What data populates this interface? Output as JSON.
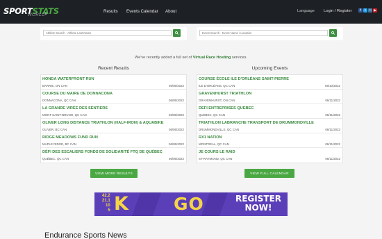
{
  "header": {
    "logo_sport": "SPORT",
    "logo_stats": "STATS",
    "logo_world": "WORLD",
    "nav": [
      "Results",
      "Events Calendar",
      "About"
    ],
    "language": "Language",
    "login": "Login / Register",
    "social_icons": [
      "facebook-icon",
      "twitter-icon",
      "instagram-icon",
      "youtube-icon"
    ]
  },
  "search": {
    "athlete_placeholder": "Athlete Search - Athlete Last Name",
    "event_placeholder": "Event Search - Event Name / Location"
  },
  "promo": {
    "text_before": "We've recently added a full set of ",
    "link": "Virtual Race Hosting",
    "text_after": " services."
  },
  "recent": {
    "title": "Recent Results",
    "items": [
      {
        "name": "HONDA WATERFRONT RUN",
        "location": "BARRIE, ON CAN",
        "date": "06/05/2022"
      },
      {
        "name": "COURSE DU MAIRE DE DONNACONA",
        "location": "DONNACONA, QC CAN",
        "date": "06/05/2022"
      },
      {
        "name": "LA GRANDE VIRÉE DES SENTIERS",
        "location": "MONT-SAINT-BRUNO, QC CAN",
        "date": "06/05/2022"
      },
      {
        "name": "OLIVER LONG DISTANCE TRIATHLON (HALF-IRON) & AQUABIKE",
        "location": "OLIVER, BC CAN",
        "date": "06/05/2022"
      },
      {
        "name": "RIDGE MEADOWS FUND RUN",
        "location": "MAPLE RIDGE, BC CAN",
        "date": "06/05/2022"
      },
      {
        "name": "DÉFI DES ESCALIERS FONDS DE SOLIDARITÉ FTQ DE QUÉBEC",
        "location": "QUÉBEC, QC CAN",
        "date": "06/05/2022"
      }
    ],
    "button": "VIEW MORE RESULTS"
  },
  "upcoming": {
    "title": "Upcoming Events",
    "items": [
      {
        "name": "COURSE ÉCOLE ILE D'ORLÉANS SAINT-PIERRE",
        "location": "ILE D'ORLÉANS, QC CAN",
        "date": "06/10/2022"
      },
      {
        "name": "GRAVENHURST TRIATHLON",
        "location": "GRAVENHURST, ON CAN",
        "date": "06/11/2022"
      },
      {
        "name": "DEFI ENTREPRISES QUEBEC",
        "location": "QUEBEC, QC CAN",
        "date": "06/11/2022"
      },
      {
        "name": "TRIATHLON LABRANCHE TRANSPORT DE DRUMMONDVILLE",
        "location": "DRUMMONDVILLE, QC CAN",
        "date": "06/11/2022"
      },
      {
        "name": "RX1 NATION",
        "location": "MONTREAL, QC CAN",
        "date": "06/11/2022"
      },
      {
        "name": "JE COURS LE RAID",
        "location": "ST-RAYMOND, QC CAN",
        "date": "06/11/2022"
      }
    ],
    "button": "VIEW FULL CALENDAR"
  },
  "banner": {
    "distances": [
      "42.2",
      "21.1",
      "10",
      "5"
    ],
    "k": "K",
    "go": "GO",
    "register_line1": "REGISTER",
    "register_line2": "NOW!",
    "colors": {
      "background": "#5b3fb8",
      "accent": "#f5d547"
    }
  },
  "news": {
    "title": "Endurance Sports News"
  },
  "colors": {
    "topbar": "#1d2024",
    "accent_green": "#4aa843",
    "link_green": "#3a8a3f"
  }
}
